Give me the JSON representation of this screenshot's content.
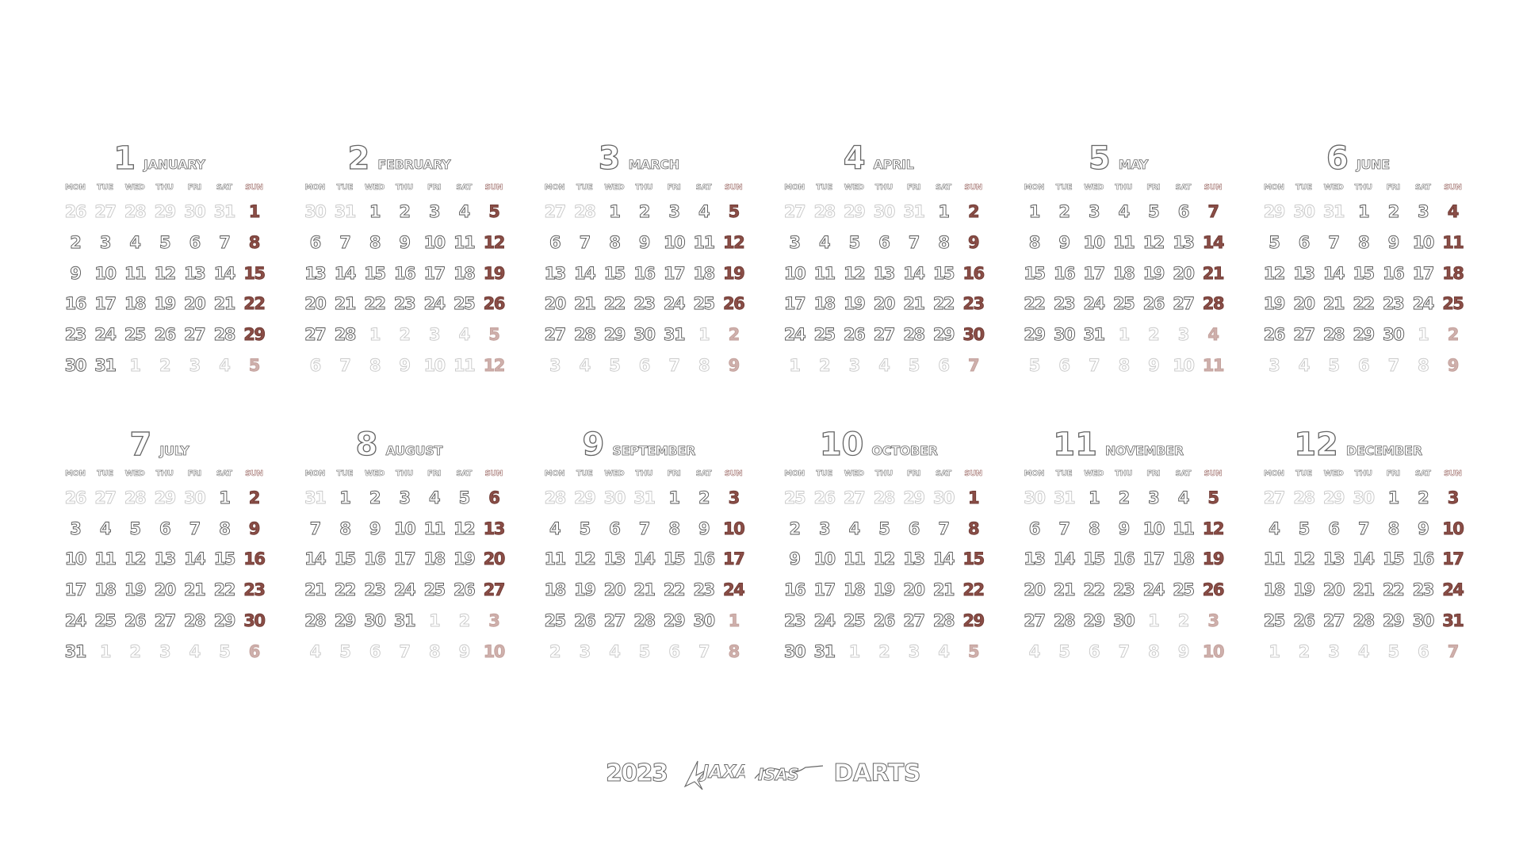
{
  "weekdays": [
    "MON",
    "TUE",
    "WED",
    "THU",
    "FRI",
    "SAT",
    "SUN"
  ],
  "months": [
    {
      "number": "1",
      "name": "JANUARY",
      "weeks": [
        [
          "26",
          "27",
          "28",
          "29",
          "30",
          "31",
          "1"
        ],
        [
          "2",
          "3",
          "4",
          "5",
          "6",
          "7",
          "8"
        ],
        [
          "9",
          "10",
          "11",
          "12",
          "13",
          "14",
          "15"
        ],
        [
          "16",
          "17",
          "18",
          "19",
          "20",
          "21",
          "22"
        ],
        [
          "23",
          "24",
          "25",
          "26",
          "27",
          "28",
          "29"
        ],
        [
          "30",
          "31",
          "1",
          "2",
          "3",
          "4",
          "5"
        ]
      ]
    },
    {
      "number": "2",
      "name": "FEBRUARY",
      "weeks": [
        [
          "30",
          "31",
          "1",
          "2",
          "3",
          "4",
          "5"
        ],
        [
          "6",
          "7",
          "8",
          "9",
          "10",
          "11",
          "12"
        ],
        [
          "13",
          "14",
          "15",
          "16",
          "17",
          "18",
          "19"
        ],
        [
          "20",
          "21",
          "22",
          "23",
          "24",
          "25",
          "26"
        ],
        [
          "27",
          "28",
          "1",
          "2",
          "3",
          "4",
          "5"
        ],
        [
          "6",
          "7",
          "8",
          "9",
          "10",
          "11",
          "12"
        ]
      ]
    },
    {
      "number": "3",
      "name": "MARCH",
      "weeks": [
        [
          "27",
          "28",
          "1",
          "2",
          "3",
          "4",
          "5"
        ],
        [
          "6",
          "7",
          "8",
          "9",
          "10",
          "11",
          "12"
        ],
        [
          "13",
          "14",
          "15",
          "16",
          "17",
          "18",
          "19"
        ],
        [
          "20",
          "21",
          "22",
          "23",
          "24",
          "25",
          "26"
        ],
        [
          "27",
          "28",
          "29",
          "30",
          "31",
          "1",
          "2"
        ],
        [
          "3",
          "4",
          "5",
          "6",
          "7",
          "8",
          "9"
        ]
      ]
    },
    {
      "number": "4",
      "name": "APRIL",
      "weeks": [
        [
          "27",
          "28",
          "29",
          "30",
          "31",
          "1",
          "2"
        ],
        [
          "3",
          "4",
          "5",
          "6",
          "7",
          "8",
          "9"
        ],
        [
          "10",
          "11",
          "12",
          "13",
          "14",
          "15",
          "16"
        ],
        [
          "17",
          "18",
          "19",
          "20",
          "21",
          "22",
          "23"
        ],
        [
          "24",
          "25",
          "26",
          "27",
          "28",
          "29",
          "30"
        ],
        [
          "1",
          "2",
          "3",
          "4",
          "5",
          "6",
          "7"
        ]
      ]
    },
    {
      "number": "5",
      "name": "MAY",
      "weeks": [
        [
          "1",
          "2",
          "3",
          "4",
          "5",
          "6",
          "7"
        ],
        [
          "8",
          "9",
          "10",
          "11",
          "12",
          "13",
          "14"
        ],
        [
          "15",
          "16",
          "17",
          "18",
          "19",
          "20",
          "21"
        ],
        [
          "22",
          "23",
          "24",
          "25",
          "26",
          "27",
          "28"
        ],
        [
          "29",
          "30",
          "31",
          "1",
          "2",
          "3",
          "4"
        ],
        [
          "5",
          "6",
          "7",
          "8",
          "9",
          "10",
          "11"
        ]
      ]
    },
    {
      "number": "6",
      "name": "JUNE",
      "weeks": [
        [
          "29",
          "30",
          "31",
          "1",
          "2",
          "3",
          "4"
        ],
        [
          "5",
          "6",
          "7",
          "8",
          "9",
          "10",
          "11"
        ],
        [
          "12",
          "13",
          "14",
          "15",
          "16",
          "17",
          "18"
        ],
        [
          "19",
          "20",
          "21",
          "22",
          "23",
          "24",
          "25"
        ],
        [
          "26",
          "27",
          "28",
          "29",
          "30",
          "1",
          "2"
        ],
        [
          "3",
          "4",
          "5",
          "6",
          "7",
          "8",
          "9"
        ]
      ]
    },
    {
      "number": "7",
      "name": "JULY",
      "weeks": [
        [
          "26",
          "27",
          "28",
          "29",
          "30",
          "1",
          "2"
        ],
        [
          "3",
          "4",
          "5",
          "6",
          "7",
          "8",
          "9"
        ],
        [
          "10",
          "11",
          "12",
          "13",
          "14",
          "15",
          "16"
        ],
        [
          "17",
          "18",
          "19",
          "20",
          "21",
          "22",
          "23"
        ],
        [
          "24",
          "25",
          "26",
          "27",
          "28",
          "29",
          "30"
        ],
        [
          "31",
          "1",
          "2",
          "3",
          "4",
          "5",
          "6"
        ]
      ]
    },
    {
      "number": "8",
      "name": "AUGUST",
      "weeks": [
        [
          "31",
          "1",
          "2",
          "3",
          "4",
          "5",
          "6"
        ],
        [
          "7",
          "8",
          "9",
          "10",
          "11",
          "12",
          "13"
        ],
        [
          "14",
          "15",
          "16",
          "17",
          "18",
          "19",
          "20"
        ],
        [
          "21",
          "22",
          "23",
          "24",
          "25",
          "26",
          "27"
        ],
        [
          "28",
          "29",
          "30",
          "31",
          "1",
          "2",
          "3"
        ],
        [
          "4",
          "5",
          "6",
          "7",
          "8",
          "9",
          "10"
        ]
      ]
    },
    {
      "number": "9",
      "name": "SEPTEMBER",
      "weeks": [
        [
          "28",
          "29",
          "30",
          "31",
          "1",
          "2",
          "3"
        ],
        [
          "4",
          "5",
          "6",
          "7",
          "8",
          "9",
          "10"
        ],
        [
          "11",
          "12",
          "13",
          "14",
          "15",
          "16",
          "17"
        ],
        [
          "18",
          "19",
          "20",
          "21",
          "22",
          "23",
          "24"
        ],
        [
          "25",
          "26",
          "27",
          "28",
          "29",
          "30",
          "1"
        ],
        [
          "2",
          "3",
          "4",
          "5",
          "6",
          "7",
          "8"
        ]
      ]
    },
    {
      "number": "10",
      "name": "OCTOBER",
      "weeks": [
        [
          "25",
          "26",
          "27",
          "28",
          "29",
          "30",
          "1"
        ],
        [
          "2",
          "3",
          "4",
          "5",
          "6",
          "7",
          "8"
        ],
        [
          "9",
          "10",
          "11",
          "12",
          "13",
          "14",
          "15"
        ],
        [
          "16",
          "17",
          "18",
          "19",
          "20",
          "21",
          "22"
        ],
        [
          "23",
          "24",
          "25",
          "26",
          "27",
          "28",
          "29"
        ],
        [
          "30",
          "31",
          "1",
          "2",
          "3",
          "4",
          "5"
        ]
      ]
    },
    {
      "number": "11",
      "name": "NOVEMBER",
      "weeks": [
        [
          "30",
          "31",
          "1",
          "2",
          "3",
          "4",
          "5"
        ],
        [
          "6",
          "7",
          "8",
          "9",
          "10",
          "11",
          "12"
        ],
        [
          "13",
          "14",
          "15",
          "16",
          "17",
          "18",
          "19"
        ],
        [
          "20",
          "21",
          "22",
          "23",
          "24",
          "25",
          "26"
        ],
        [
          "27",
          "28",
          "29",
          "30",
          "1",
          "2",
          "3"
        ],
        [
          "4",
          "5",
          "6",
          "7",
          "8",
          "9",
          "10"
        ]
      ]
    },
    {
      "number": "12",
      "name": "DECEMBER",
      "weeks": [
        [
          "27",
          "28",
          "29",
          "30",
          "1",
          "2",
          "3"
        ],
        [
          "4",
          "5",
          "6",
          "7",
          "8",
          "9",
          "10"
        ],
        [
          "11",
          "12",
          "13",
          "14",
          "15",
          "16",
          "17"
        ],
        [
          "18",
          "19",
          "20",
          "21",
          "22",
          "23",
          "24"
        ],
        [
          "25",
          "26",
          "27",
          "28",
          "29",
          "30",
          "31"
        ],
        [
          "1",
          "2",
          "3",
          "4",
          "5",
          "6",
          "7"
        ]
      ]
    }
  ],
  "footer": {
    "year": "2023",
    "logo_jaxa": "JAXA",
    "logo_isas": "ISAS",
    "brand": "DARTS"
  },
  "colors": {
    "outline": "#555555",
    "other_month_outline": "#c8c8c8",
    "sunday_fill": "#8b4e47",
    "sunday_other_fill": "#cfb0ac"
  }
}
